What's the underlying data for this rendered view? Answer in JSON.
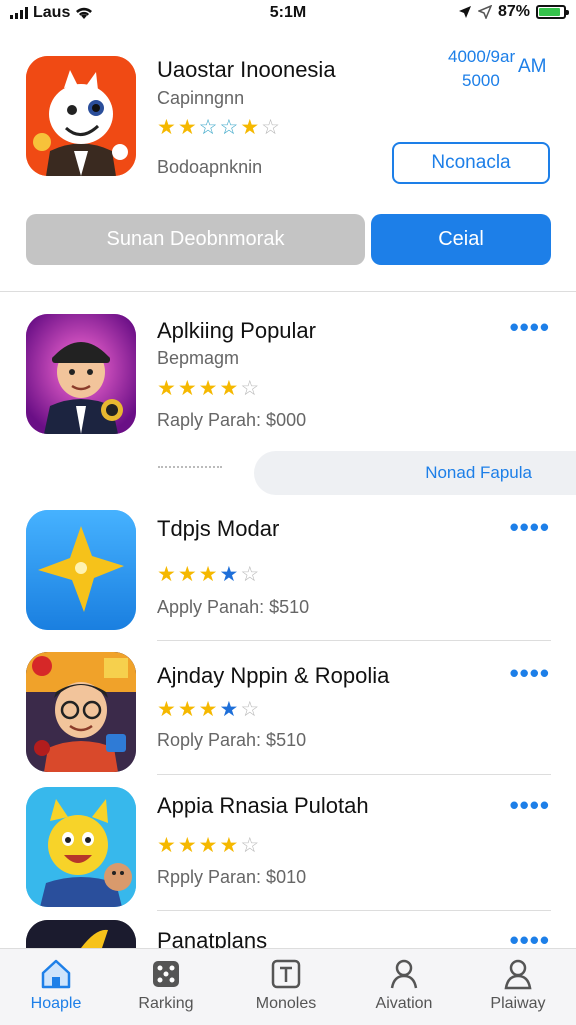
{
  "status_bar": {
    "carrier": "Laus",
    "time": "5:1M",
    "battery": "87%",
    "battery_level": 0.87
  },
  "featured": {
    "title": "Uaostar Inoonesia",
    "subtitle": "Capinngnn",
    "rating": 3.5,
    "meta": "Bodoapnknin",
    "price_line1": "4000/9ar",
    "price_line2": "AM",
    "price_line3": "5000",
    "outline_button": "Nconacla",
    "gray_button": "Sunan Deobnmorak",
    "blue_button": "Ceial"
  },
  "list": {
    "items": [
      {
        "title": "Aplkiing Popular",
        "subtitle": "Bepmagm",
        "meta": "Raply Parah: $000",
        "rating": 4
      },
      {
        "title": "Tdpjs Modar",
        "subtitle": "",
        "meta": "Apply Panah: $510",
        "rating": 3.5
      },
      {
        "title": "Ajnday Nppin & Ropolia",
        "subtitle": "",
        "meta": "Roply Parah: $510",
        "rating": 3.5
      },
      {
        "title": "Appia Rnasia Pulotah",
        "subtitle": "",
        "meta": "Rpply Paran: $010",
        "rating": 3.5
      },
      {
        "title": "Panatplans",
        "subtitle": "",
        "meta": "",
        "rating": 0
      }
    ],
    "section_pill": "Nonad Fapula"
  },
  "tabs": [
    {
      "label": "Hoaple",
      "icon": "home-icon",
      "active": true
    },
    {
      "label": "Rarking",
      "icon": "dice-icon",
      "active": false
    },
    {
      "label": "Monoles",
      "icon": "text-box-icon",
      "active": false
    },
    {
      "label": "Aivation",
      "icon": "person-icon",
      "active": false
    },
    {
      "label": "Plaiway",
      "icon": "profile-icon",
      "active": false
    }
  ],
  "colors": {
    "accent": "#1d7fe8",
    "star": "#f5b800",
    "gray_button": "#c4c4c4"
  }
}
